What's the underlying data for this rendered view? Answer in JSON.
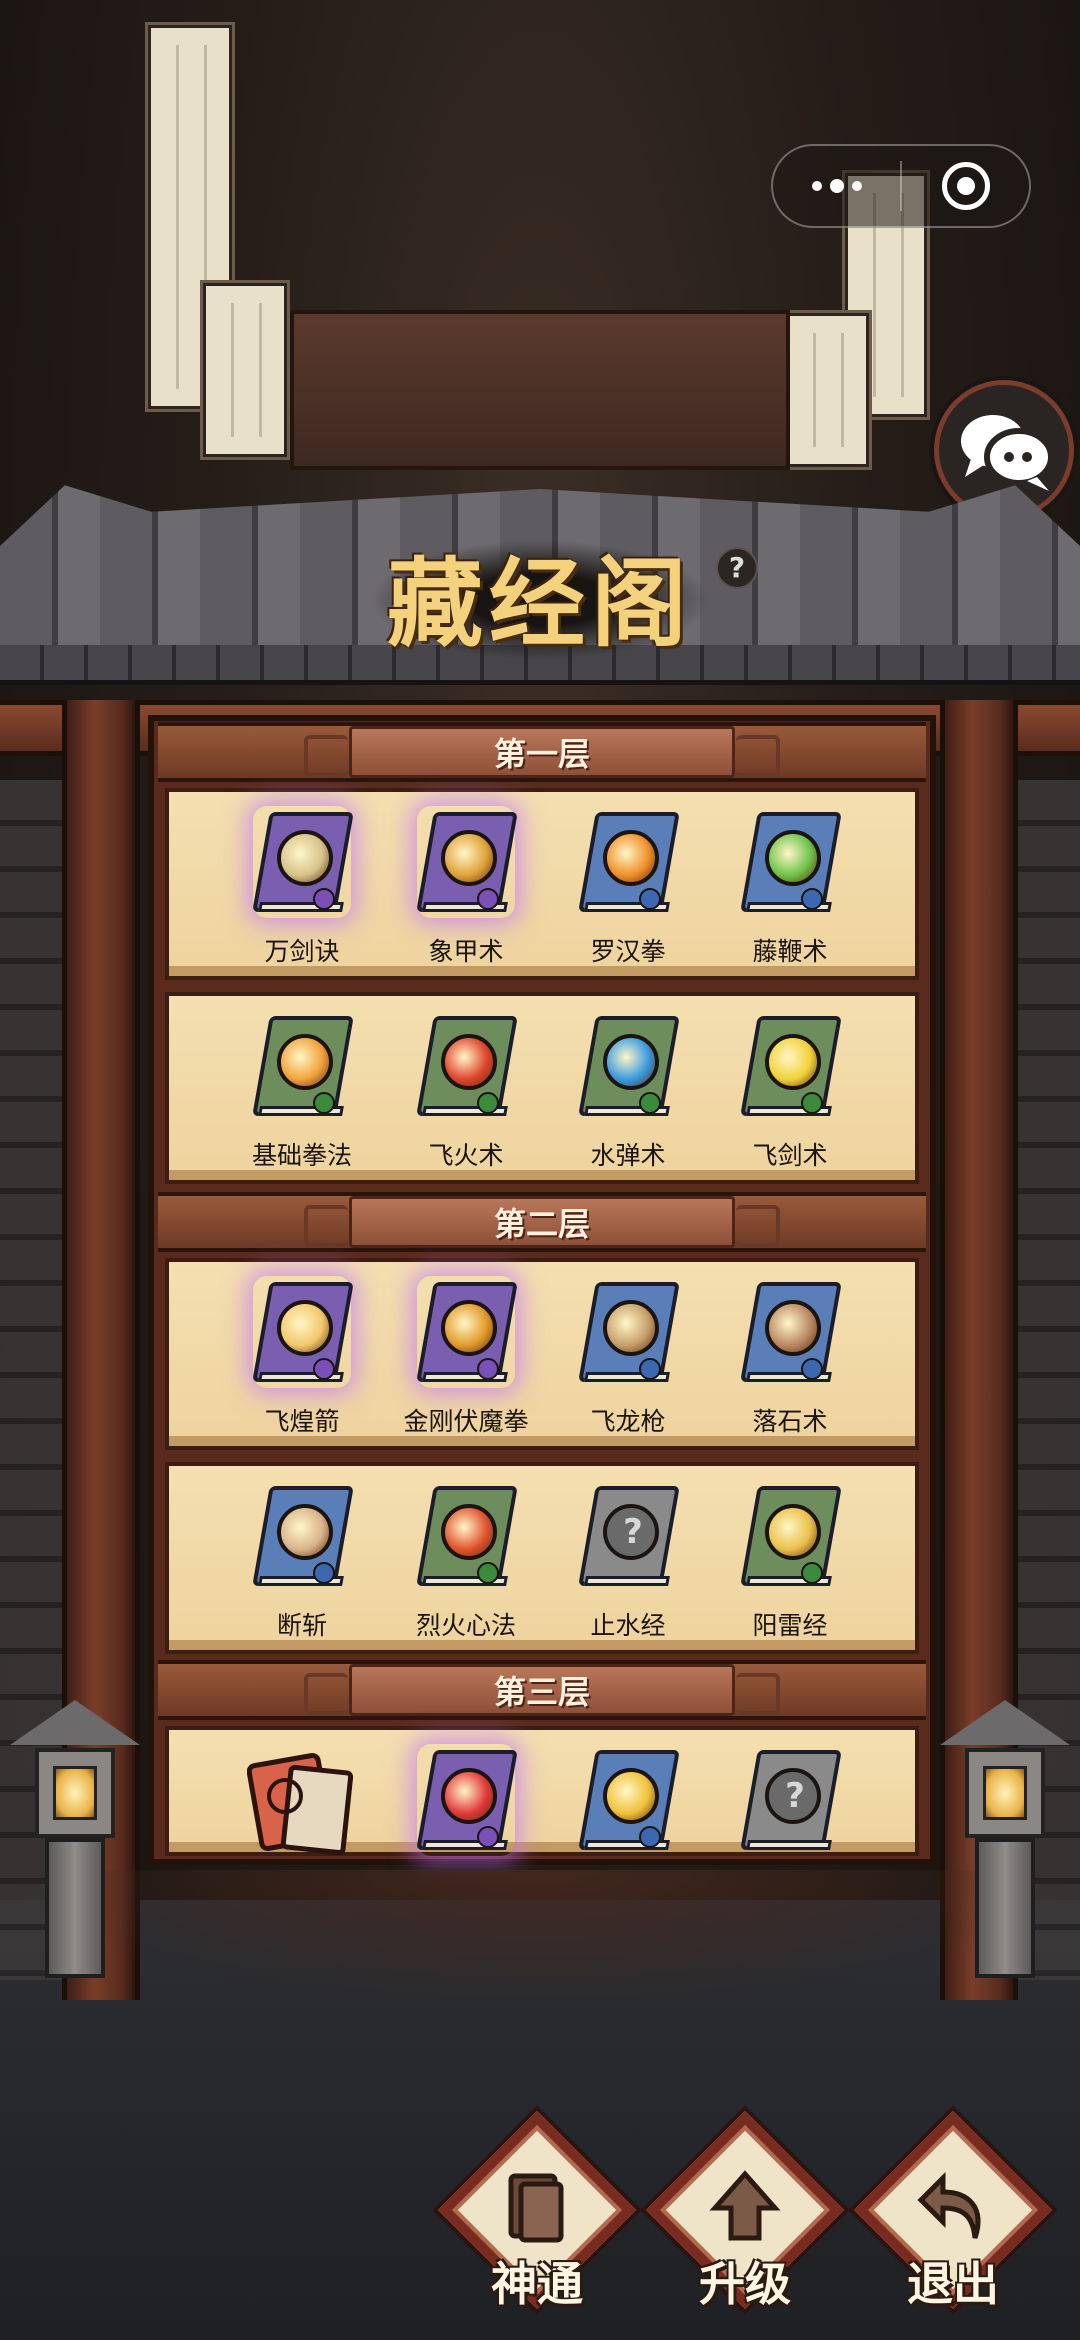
{
  "title": "藏经阁",
  "help": "?",
  "capsule": {
    "more_icon": "more-dots-icon",
    "close_icon": "target-icon"
  },
  "chat_icon": "chat-bubble-icon",
  "floors": [
    {
      "name": "第一层",
      "rows": [
        [
          {
            "label": "万剑诀",
            "rarity": "purple",
            "orb": "#d6c28a",
            "cover": "#7a5fb0"
          },
          {
            "label": "象甲术",
            "rarity": "purple",
            "orb": "#e0a23a",
            "cover": "#7a5fb0"
          },
          {
            "label": "罗汉拳",
            "rarity": "blue",
            "orb": "#f0902a",
            "cover": "#5a7fb8"
          },
          {
            "label": "藤鞭术",
            "rarity": "blue",
            "orb": "#6fc34a",
            "cover": "#5a7fb8"
          }
        ],
        [
          {
            "label": "基础拳法",
            "rarity": "green",
            "orb": "#f2a23a",
            "cover": "#6e8d5d"
          },
          {
            "label": "飞火术",
            "rarity": "green",
            "orb": "#e0452e",
            "cover": "#6e8d5d"
          },
          {
            "label": "水弹术",
            "rarity": "green",
            "orb": "#3a9be0",
            "cover": "#6e8d5d"
          },
          {
            "label": "飞剑术",
            "rarity": "green",
            "orb": "#f2d23a",
            "cover": "#6e8d5d"
          }
        ]
      ]
    },
    {
      "name": "第二层",
      "rows": [
        [
          {
            "label": "飞煌箭",
            "rarity": "purple",
            "orb": "#f3c86a",
            "cover": "#7a5fb0"
          },
          {
            "label": "金刚伏魔拳",
            "rarity": "purple",
            "orb": "#e39a2c",
            "cover": "#7a5fb0"
          },
          {
            "label": "飞龙枪",
            "rarity": "blue",
            "orb": "#c6a06a",
            "cover": "#5a7fb8"
          },
          {
            "label": "落石术",
            "rarity": "blue",
            "orb": "#b98a62",
            "cover": "#5a7fb8"
          }
        ],
        [
          {
            "label": "断斩",
            "rarity": "blue",
            "orb": "#d9b48a",
            "cover": "#5a7fb8"
          },
          {
            "label": "烈火心法",
            "rarity": "green",
            "orb": "#e0542e",
            "cover": "#6e8d5d"
          },
          {
            "label": "止水经",
            "rarity": "unknown",
            "orb": "#6a6a6a",
            "cover": "#8a8a8a"
          },
          {
            "label": "阳雷经",
            "rarity": "green",
            "orb": "#e9c04a",
            "cover": "#6e8d5d"
          }
        ]
      ]
    },
    {
      "name": "第三层",
      "rows": [
        [
          {
            "label": "",
            "rarity": "scroll",
            "orb": "#d9624a",
            "cover": "#e6d9bf"
          },
          {
            "label": "",
            "rarity": "purple",
            "orb": "#e23a3a",
            "cover": "#7a5fb0"
          },
          {
            "label": "",
            "rarity": "blue",
            "orb": "#f0c23a",
            "cover": "#5a7fb8"
          },
          {
            "label": "",
            "rarity": "unknown",
            "orb": "#6a6a6a",
            "cover": "#8a8a8a"
          }
        ]
      ]
    }
  ],
  "bottom_buttons": [
    {
      "label": "神通",
      "icon": "book-icon"
    },
    {
      "label": "升级",
      "icon": "upgrade-icon"
    },
    {
      "label": "退出",
      "icon": "return-arrow-icon"
    }
  ],
  "colors": {
    "title_gold": "#f4d27d",
    "wood": "#7a3d29",
    "shelf": "#f4dfb0"
  }
}
